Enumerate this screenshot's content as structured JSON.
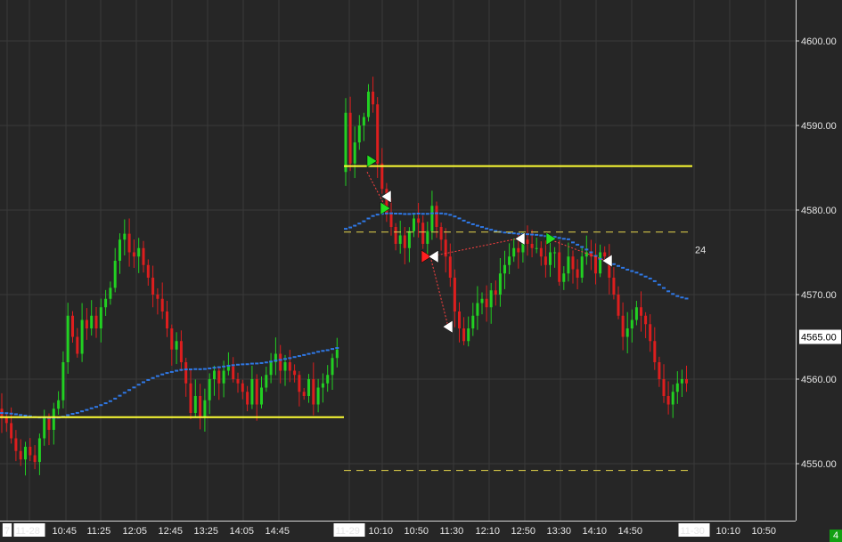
{
  "chart_data": {
    "type": "candlestick",
    "title": "",
    "ylim": [
      4542.5,
      4602.3
    ],
    "y_ticks": [
      4600,
      4590,
      4580,
      4570,
      4560,
      4550
    ],
    "y_tick_labels": [
      "4600.00",
      "4590.00",
      "4580.00",
      "4570.00",
      "4560.00",
      "4550.00"
    ],
    "last_price_label": "4565.00",
    "ma_label": "24",
    "corner_badge": "4",
    "x_labels": [
      {
        "text": "7",
        "highlight": true
      },
      {
        "text": "11-28",
        "highlight": true
      },
      {
        "text": "10:45",
        "highlight": false
      },
      {
        "text": "11:25",
        "highlight": false
      },
      {
        "text": "12:05",
        "highlight": false
      },
      {
        "text": "12:45",
        "highlight": false
      },
      {
        "text": "13:25",
        "highlight": false
      },
      {
        "text": "14:05",
        "highlight": false
      },
      {
        "text": "14:45",
        "highlight": false
      },
      {
        "text": "11-29",
        "highlight": true
      },
      {
        "text": "10:10",
        "highlight": false
      },
      {
        "text": "10:50",
        "highlight": false
      },
      {
        "text": "11:30",
        "highlight": false
      },
      {
        "text": "12:10",
        "highlight": false
      },
      {
        "text": "12:50",
        "highlight": false
      },
      {
        "text": "13:30",
        "highlight": false
      },
      {
        "text": "14:10",
        "highlight": false
      },
      {
        "text": "14:50",
        "highlight": false
      },
      {
        "text": "11-30",
        "highlight": true
      },
      {
        "text": "10:10",
        "highlight": false
      },
      {
        "text": "10:50",
        "highlight": false
      }
    ],
    "day1_closes": [
      4555.5,
      4554.8,
      4553,
      4551.5,
      4550.5,
      4552,
      4551,
      4550.2,
      4553,
      4555.5,
      4554,
      4556.5,
      4557.5,
      4562,
      4567.5,
      4565,
      4563,
      4567,
      4566,
      4567.5,
      4566,
      4568.5,
      4569.5,
      4570.8,
      4574,
      4576.5,
      4577.2,
      4575,
      4574.5,
      4575.5,
      4573.5,
      4572,
      4570,
      4569.5,
      4568,
      4566,
      4563.5,
      4564.5,
      4562,
      4559.5,
      4556,
      4558,
      4555.5,
      4557.5,
      4560,
      4561,
      4559.5,
      4561,
      4561.5,
      4560,
      4559.5,
      4558.5,
      4557,
      4560,
      4557,
      4559,
      4560.5,
      4562,
      4563,
      4561,
      4562,
      4561,
      4560.5,
      4558.5,
      4558,
      4560,
      4557,
      4559,
      4559.5,
      4560.5,
      4562.5,
      4563.5
    ],
    "day2_closes": [
      4591.5,
      4585.5,
      4588,
      4590,
      4591,
      4594,
      4592.5,
      4585.5,
      4582.5,
      4579.5,
      4578,
      4576,
      4577,
      4575.5,
      4577.5,
      4579,
      4578.5,
      4576,
      4577.5,
      4580.5,
      4578,
      4576.5,
      4574.5,
      4572,
      4568,
      4566,
      4564.5,
      4566,
      4567.5,
      4569,
      4569.5,
      4568.5,
      4570.5,
      4570,
      4572.5,
      4573.5,
      4574.5,
      4575.5,
      4575,
      4576.5,
      4576,
      4575.5,
      4575.5,
      4574.5,
      4573.5,
      4575,
      4575,
      4571.5,
      4572.5,
      4574.5,
      4573,
      4572,
      4574.5,
      4575,
      4574.5,
      4572.5,
      4575,
      4574.5,
      4572,
      4570,
      4567.5,
      4565,
      4566,
      4567,
      4568.5,
      4567.5,
      4566.5,
      4564.5,
      4562,
      4560,
      4558,
      4557,
      4558.5,
      4559.5,
      4560,
      4559.5
    ],
    "horizontal_lines": [
      {
        "name": "day1-level",
        "y": 4555.5,
        "style": "solid",
        "color": "#ffff33"
      },
      {
        "name": "day2-upper-level",
        "y": 4585.2,
        "style": "solid",
        "color": "#ffff33"
      },
      {
        "name": "day2-dashed-mid",
        "y": 4577.4,
        "style": "dashed",
        "color": "#e6d64a"
      },
      {
        "name": "day2-dashed-low",
        "y": 4549.2,
        "style": "dashed",
        "color": "#e6d64a"
      }
    ],
    "colors": {
      "background": "#262626",
      "grid": "#3a3a3a",
      "up_candle": "#22d022",
      "down_candle": "#dd1e1e",
      "moving_average": "#2f78e6",
      "marker_buy": "#22e022",
      "marker_sell": "#ffffff",
      "marker_entry": "#ff2020",
      "trade_line": "#ff4040",
      "last_price_box": "#ffffff",
      "corner_badge": "#12a012"
    }
  }
}
